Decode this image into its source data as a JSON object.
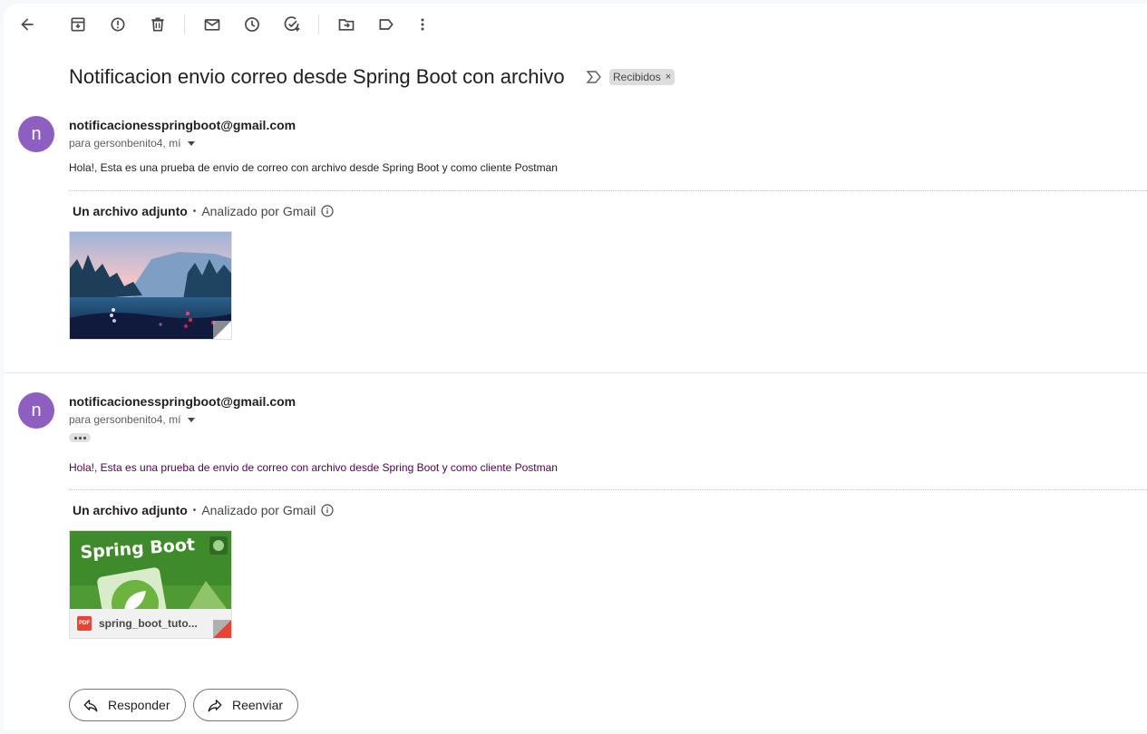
{
  "toolbar": {
    "icons": [
      "back-arrow-icon",
      "archive-icon",
      "report-spam-icon",
      "delete-icon",
      "mark-unread-icon",
      "snooze-icon",
      "add-task-icon",
      "move-to-icon",
      "label-icon",
      "more-vert-icon"
    ]
  },
  "subject": "Notificacion envio correo desde Spring Boot con archivo",
  "label_chip": {
    "text": "Recibidos",
    "remove": "×"
  },
  "messages": [
    {
      "avatar_letter": "n",
      "sender": "notificacionesspringboot@gmail.com",
      "recipient": "para gersonbenito4, mí",
      "body": "Hola!, Esta es una prueba de envio de correo con archivo desde Spring Boot y como cliente Postman",
      "attachments_title": "Un archivo adjunto",
      "scanned": "Analizado por Gmail"
    },
    {
      "avatar_letter": "n",
      "sender": "notificacionesspringboot@gmail.com",
      "recipient": "para gersonbenito4, mí",
      "body": "Hola!, Esta es una prueba de envio de correo con archivo desde Spring Boot y como cliente Postman",
      "attachments_title": "Un archivo adjunto",
      "scanned": "Analizado por Gmail",
      "attachment_thumb_text": "Spring Boot",
      "attachment_name": "spring_boot_tuto...",
      "attachment_badge": "PDF"
    }
  ],
  "actions": {
    "reply": "Responder",
    "forward": "Reenviar"
  },
  "colors": {
    "avatar": "#8e5ec1",
    "quoted_text": "#500050",
    "pdf_red": "#ea4335"
  }
}
